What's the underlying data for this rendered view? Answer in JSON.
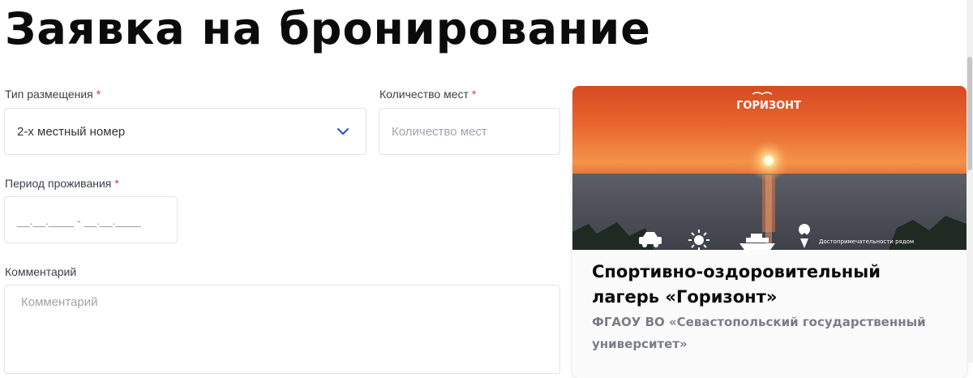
{
  "page": {
    "title": "Заявка на бронирование"
  },
  "form": {
    "accommodation": {
      "label": "Тип размещения",
      "required_mark": "*",
      "value": "2-х местный номер"
    },
    "seats": {
      "label": "Количество мест",
      "required_mark": "*",
      "placeholder": "Количество мест"
    },
    "period": {
      "label": "Период проживания",
      "required_mark": "*",
      "value": "__.__.____ - __.__.____"
    },
    "comment": {
      "label": "Комментарий",
      "placeholder": "Комментарий"
    }
  },
  "card": {
    "logo_text": "ГОРИЗОНТ",
    "nearby_text": "Достопримечательности рядом",
    "icons": [
      "car-icon",
      "sun-icon",
      "ship-icon",
      "location-pin-icon"
    ],
    "title": "Спортивно-оздоровительный лагерь «Горизонт»",
    "subtitle": "ФГАОУ ВО «Севастопольский государственный университет»"
  },
  "colors": {
    "accent": "#1f4fd1",
    "required": "#e4343d",
    "border": "#dfe2e8"
  }
}
